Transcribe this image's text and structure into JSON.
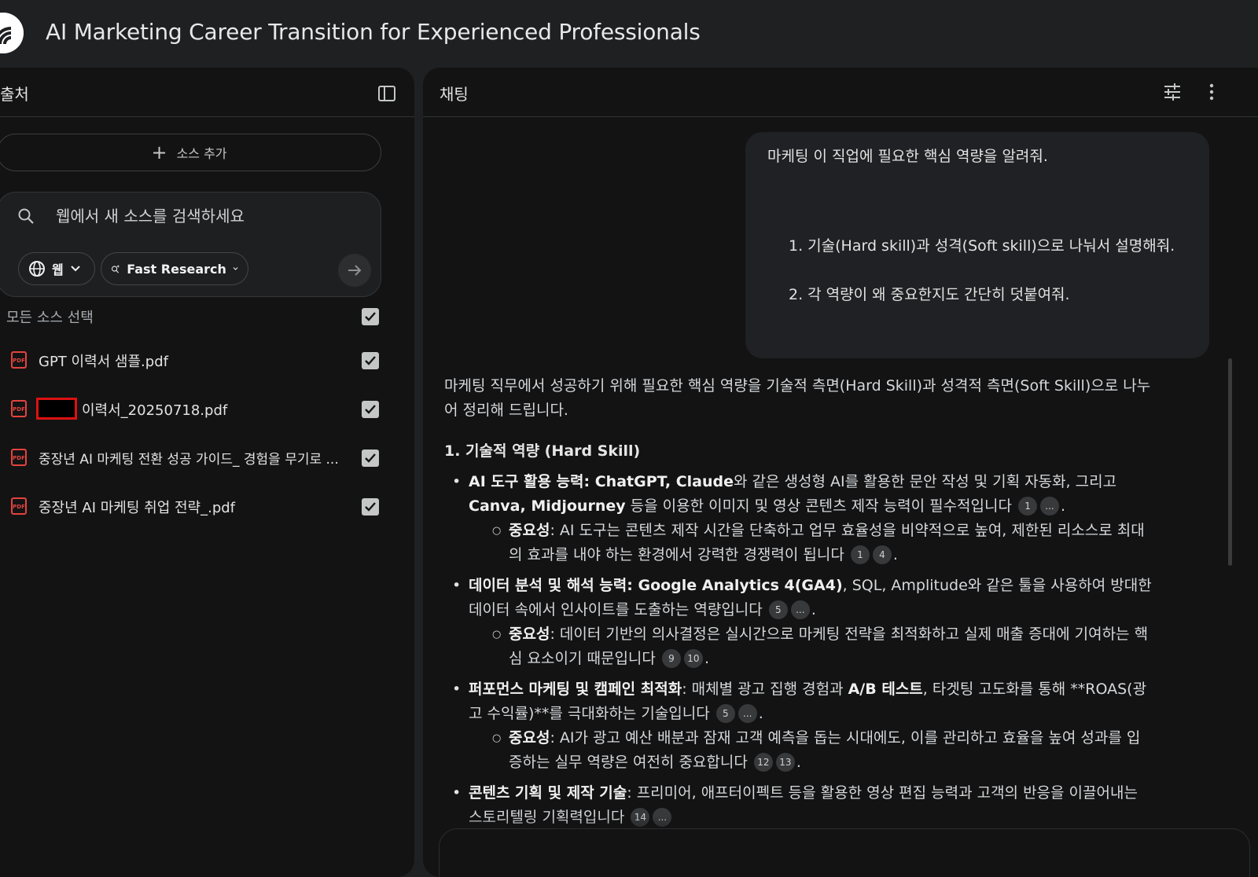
{
  "app": {
    "title": "AI Marketing Career Transition for Experienced Professionals",
    "logo_icon": "notebook-logo-icon"
  },
  "sources_panel": {
    "title": "출처",
    "collapse_icon": "panel-collapse-icon",
    "add_source_label": "소스 추가",
    "search": {
      "placeholder": "웹에서 새 소스를 검색하세요",
      "source_chip": "웹",
      "mode_chip": "Fast Research"
    },
    "select_all_label": "모든 소스 선택",
    "select_all_checked": true,
    "items": [
      {
        "label": "GPT 이력서 샘플.pdf",
        "checked": true,
        "icon": "pdf-icon"
      },
      {
        "label": "이력서_20250718.pdf",
        "checked": true,
        "icon": "pdf-icon",
        "redacted_prefix": true
      },
      {
        "label": "중장년 AI 마케팅 전환 성공 가이드_ 경험을 무기로 ...",
        "checked": true,
        "icon": "pdf-icon"
      },
      {
        "label": "중장년 AI 마케팅 취업 전략_.pdf",
        "checked": true,
        "icon": "pdf-icon"
      }
    ]
  },
  "chat_panel": {
    "title": "채팅",
    "user_message": {
      "line1": "마케팅 이 직업에 필요한 핵심 역량을 알려줘.",
      "item1": "1. 기술(Hard skill)과 성격(Soft skill)으로 나눠서 설명해줘.",
      "item2": "2. 각 역량이 왜 중요한지도 간단히 덧붙여줘."
    },
    "response": {
      "intro": "마케팅 직무에서 성공하기 위해 필요한 핵심 역량을 기술적 측면(Hard Skill)과 성격적 측면(Soft Skill)으로 나누어 정리해 드립니다.",
      "section_heading": "1. 기술적 역량 (Hard Skill)",
      "importance_label": "중요성",
      "ellipsis": "...",
      "b1": {
        "title": "AI 도구 활용 능력",
        "emph1": "ChatGPT, Claude",
        "text1": "와 같은 생성형 AI를 활용한 문안 작성 및 기획 자동화, 그리고 ",
        "emph2": "Canva, Midjourney",
        "text2": " 등을 이용한 이미지 및 영상 콘텐츠 제작 능력이 필수적입니다",
        "cite1": "1",
        "sub": ": AI 도구는 콘텐츠 제작 시간을 단축하고 업무 효율성을 비약적으로 높여, 제한된 리소스로 최대의 효과를 내야 하는 환경에서 강력한 경쟁력이 됩니다",
        "sub_cite1": "1",
        "sub_cite2": "4"
      },
      "b2": {
        "title": "데이터 분석 및 해석 능력",
        "emph1": "Google Analytics 4(GA4)",
        "text1": ", SQL, Amplitude와 같은 툴을 사용하여 방대한 데이터 속에서 인사이트를 도출하는 역량입니다",
        "cite1": "5",
        "sub": ": 데이터 기반의 의사결정은 실시간으로 마케팅 전략을 최적화하고 실제 매출 증대에 기여하는 핵심 요소이기 때문입니다",
        "sub_cite1": "9",
        "sub_cite2": "10"
      },
      "b3": {
        "title": "퍼포먼스 마케팅 및 캠페인 최적화",
        "text1": ": 매체별 광고 집행 경험과 ",
        "emph1": "A/B 테스트",
        "text2": ", 타겟팅 고도화를 통해 **ROAS(광고 수익률)**를 극대화하는 기술입니다",
        "cite1": "5",
        "sub": ": AI가 광고 예산 배분과 잠재 고객 예측을 돕는 시대에도, 이를 관리하고 효율을 높여 성과를 입증하는 실무 역량은 여전히 중요합니다",
        "sub_cite1": "12",
        "sub_cite2": "13"
      },
      "b4": {
        "title": "콘텐츠 기획 및 제작 기술",
        "text1": ": 프리미어, 애프터이펙트 등을 활용한 영상 편집 능력과 고객의 반응을 이끌어내는 스토리텔링 기획력입니다",
        "cite1": "14"
      }
    }
  },
  "colors": {
    "background": "#1f2021",
    "panel": "#131314",
    "user_bubble": "#202124",
    "pdf_red": "#e3443e",
    "checkbox": "#c4c7c5",
    "redaction_border": "#dd1111"
  }
}
